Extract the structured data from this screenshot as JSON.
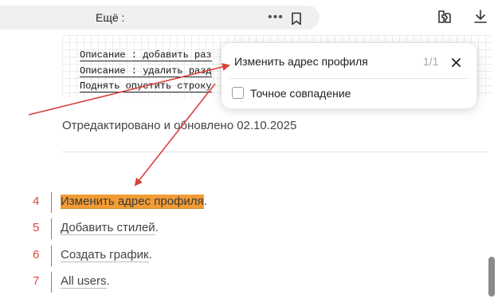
{
  "browser": {
    "address_title": "Ещё :",
    "icons": [
      "more-dots-icon",
      "bookmark-icon",
      "extensions-icon",
      "download-icon"
    ]
  },
  "code": {
    "lines": [
      "Описание : добавить раз",
      "Описание : удалить разд",
      "Поднять опустить строку"
    ]
  },
  "article": {
    "edited_text": "Отредактировано и обновлено 02.10.2025"
  },
  "list": {
    "items": [
      {
        "num": "4",
        "text": "Изменить адрес профиля",
        "suffix": "."
      },
      {
        "num": "5",
        "text": "Добавить стилей",
        "suffix": "."
      },
      {
        "num": "6",
        "text": "Создать график",
        "suffix": "."
      },
      {
        "num": "7",
        "text": "All users",
        "suffix": "."
      }
    ]
  },
  "find": {
    "query": "Изменить адрес профиля",
    "count": "1/1",
    "exact_match_label": "Точное совпадение",
    "exact_match_checked": false
  },
  "colors": {
    "highlight": "#f39c34",
    "accent_red": "#e0463a",
    "arrow": "#d9413b"
  }
}
